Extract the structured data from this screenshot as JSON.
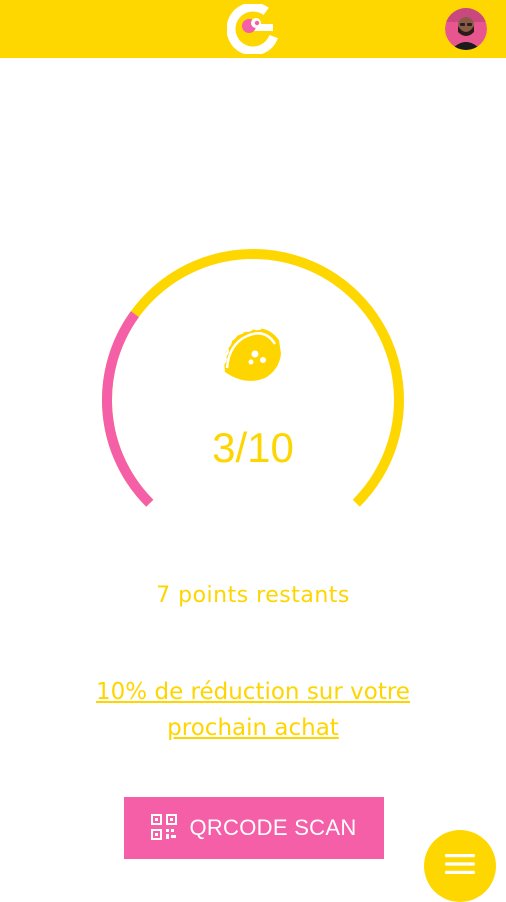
{
  "header": {
    "logo_icon": "brand-logo-icon",
    "avatar_icon": "user-avatar"
  },
  "loyalty": {
    "score": "3/10",
    "progress": 0.3,
    "reward_icon": "taco-icon",
    "remaining": "7 points restants",
    "reward_text": "10% de réduction sur votre prochain achat"
  },
  "actions": {
    "scan_label": "QRCODE SCAN",
    "scan_icon": "qrcode-icon",
    "menu_icon": "hamburger-menu-icon"
  },
  "colors": {
    "yellow": "#FFD700",
    "pink": "#F45FA8",
    "white": "#FFFFFF"
  }
}
